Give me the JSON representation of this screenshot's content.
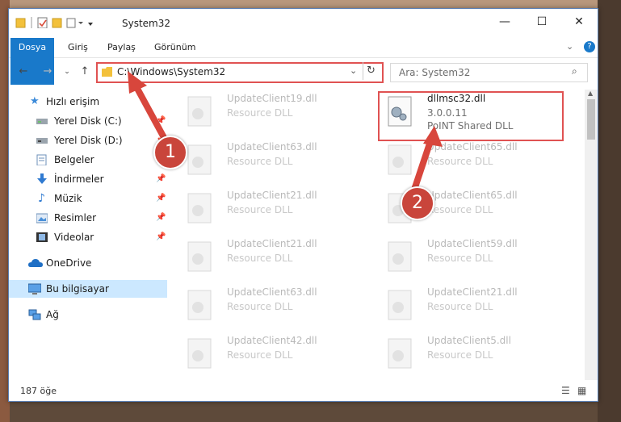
{
  "window": {
    "title": "System32",
    "minimize_glyph": "—",
    "maximize_glyph": "☐",
    "close_glyph": "✕"
  },
  "ribbon": {
    "tabs": [
      "Dosya",
      "Giriş",
      "Paylaş",
      "Görünüm"
    ],
    "accent": "#1979ca"
  },
  "address": {
    "path": "C:\\Windows\\System32",
    "search_placeholder": "Ara: System32"
  },
  "sidebar": {
    "items": [
      {
        "label": "Hızlı erişim",
        "icon": "star-icon"
      },
      {
        "label": "Yerel Disk (C:)",
        "icon": "drive-icon",
        "pinned": true
      },
      {
        "label": "Yerel Disk (D:)",
        "icon": "drive-icon",
        "pinned": true
      },
      {
        "label": "Belgeler",
        "icon": "documents-icon",
        "pinned": true
      },
      {
        "label": "İndirmeler",
        "icon": "download-icon",
        "pinned": true
      },
      {
        "label": "Müzik",
        "icon": "music-icon",
        "pinned": true
      },
      {
        "label": "Resimler",
        "icon": "pictures-icon",
        "pinned": true
      },
      {
        "label": "Videolar",
        "icon": "video-icon",
        "pinned": true
      },
      {
        "label": "OneDrive",
        "icon": "cloud-icon"
      },
      {
        "label": "Bu bilgisayar",
        "icon": "computer-icon",
        "selected": true
      },
      {
        "label": "Ağ",
        "icon": "network-icon"
      }
    ]
  },
  "files": {
    "highlighted": {
      "name": "dllmsc32.dll",
      "version": "3.0.0.11",
      "description": "PoINT Shared DLL"
    },
    "left": [
      {
        "name": "UpdateClient19.dll",
        "description": "Resource DLL"
      },
      {
        "name": "UpdateClient63.dll",
        "description": "Resource DLL"
      },
      {
        "name": "UpdateClient21.dll",
        "description": "Resource DLL"
      },
      {
        "name": "UpdateClient21.dll",
        "description": "Resource DLL"
      },
      {
        "name": "UpdateClient63.dll",
        "description": "Resource DLL"
      },
      {
        "name": "UpdateClient42.dll",
        "description": "Resource DLL"
      }
    ],
    "right": [
      {
        "name": "UpdateClient65.dll",
        "description": "Resource DLL"
      },
      {
        "name": "UpdateClient65.dll",
        "description": "Resource DLL"
      },
      {
        "name": "UpdateClient59.dll",
        "description": "Resource DLL"
      },
      {
        "name": "UpdateClient21.dll",
        "description": "Resource DLL"
      },
      {
        "name": "UpdateClient5.dll",
        "description": "Resource DLL"
      }
    ]
  },
  "status": {
    "item_count": "187 öğe"
  },
  "annotations": {
    "badge1": "1",
    "badge2": "2",
    "color": "#e05252"
  }
}
